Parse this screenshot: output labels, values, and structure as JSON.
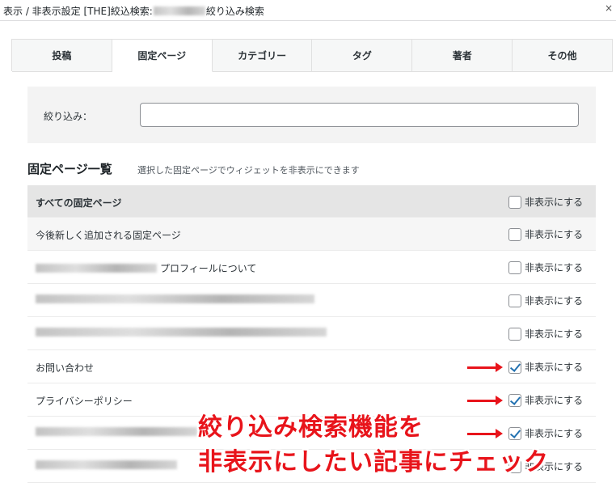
{
  "dialog": {
    "title_prefix": "表示 / 非表示設定 [THE]絞込検索:",
    "title_suffix": "絞り込み検索",
    "close_glyph": "×"
  },
  "tabs": [
    {
      "label": "投稿"
    },
    {
      "label": "固定ページ",
      "active": true
    },
    {
      "label": "カテゴリー"
    },
    {
      "label": "タグ"
    },
    {
      "label": "著者"
    },
    {
      "label": "その他"
    }
  ],
  "filter": {
    "label": "絞り込み：",
    "value": ""
  },
  "section": {
    "title": "固定ページ一覧",
    "description": "選択した固定ページでウィジェットを非表示にできます"
  },
  "rows": [
    {
      "label": "すべての固定ページ",
      "checkbox_label": "非表示にする",
      "checked": false
    },
    {
      "label": "今後新しく追加される固定ページ",
      "checkbox_label": "非表示にする",
      "checked": false
    },
    {
      "label": "プロフィールについて",
      "checkbox_label": "非表示にする",
      "checked": false
    },
    {
      "label": "",
      "checkbox_label": "非表示にする",
      "checked": false
    },
    {
      "label": "",
      "checkbox_label": "非表示にする",
      "checked": false
    },
    {
      "label": "お問い合わせ",
      "checkbox_label": "非表示にする",
      "checked": true
    },
    {
      "label": "プライバシーポリシー",
      "checkbox_label": "非表示にする",
      "checked": true
    },
    {
      "label": "",
      "checkbox_label": "非表示にする",
      "checked": true
    },
    {
      "label": "",
      "checkbox_label": "非表示にする",
      "checked": false
    }
  ],
  "annotation": {
    "line1": "絞り込み検索機能を",
    "line2": "非表示にしたい記事にチェック",
    "color": "#e8141b"
  }
}
